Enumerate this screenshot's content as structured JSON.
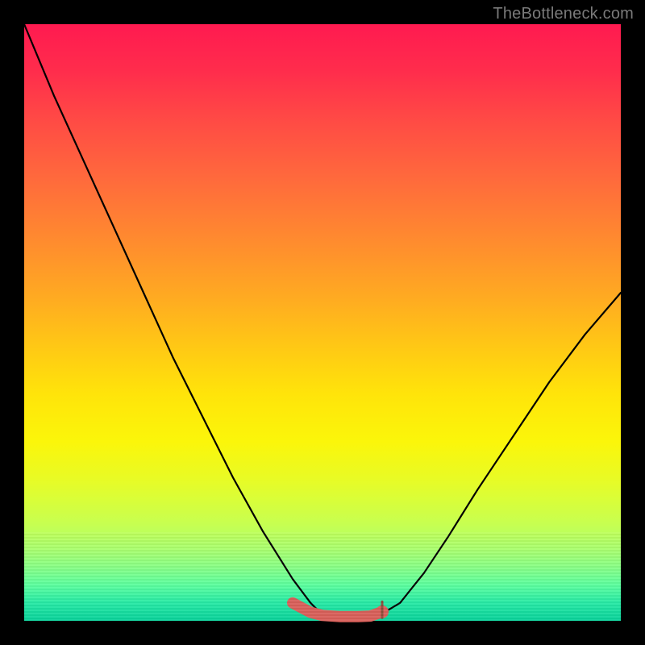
{
  "watermark": "TheBottleneck.com",
  "chart_data": {
    "type": "line",
    "title": "",
    "xlabel": "",
    "ylabel": "",
    "xlim": [
      0,
      100
    ],
    "ylim": [
      0,
      100
    ],
    "grid": false,
    "series": [
      {
        "name": "bottleneck-curve",
        "x": [
          0,
          5,
          10,
          15,
          20,
          25,
          30,
          35,
          40,
          45,
          48,
          50,
          53,
          56,
          58,
          60,
          63,
          67,
          71,
          76,
          82,
          88,
          94,
          100
        ],
        "values": [
          100,
          88,
          77,
          66,
          55,
          44,
          34,
          24,
          15,
          7,
          3,
          1,
          0.5,
          0.5,
          0.6,
          1.2,
          3,
          8,
          14,
          22,
          31,
          40,
          48,
          55
        ]
      }
    ],
    "highlight": {
      "name": "optimal-range",
      "x": [
        45,
        48,
        50,
        53,
        56,
        58,
        60
      ],
      "values": [
        3,
        1.4,
        0.9,
        0.7,
        0.7,
        0.8,
        1.5
      ],
      "endpoint_marker": {
        "x": 60,
        "value": 1.5
      },
      "tick_marker": {
        "x": 60,
        "value_from": 0.5,
        "value_to": 3.2
      }
    },
    "background": {
      "type": "vertical-gradient",
      "stops": [
        {
          "pos": 0.0,
          "color": "#ff1a50"
        },
        {
          "pos": 0.5,
          "color": "#ffc815"
        },
        {
          "pos": 0.78,
          "color": "#e9fb24"
        },
        {
          "pos": 1.0,
          "color": "#08d29a"
        }
      ]
    }
  }
}
